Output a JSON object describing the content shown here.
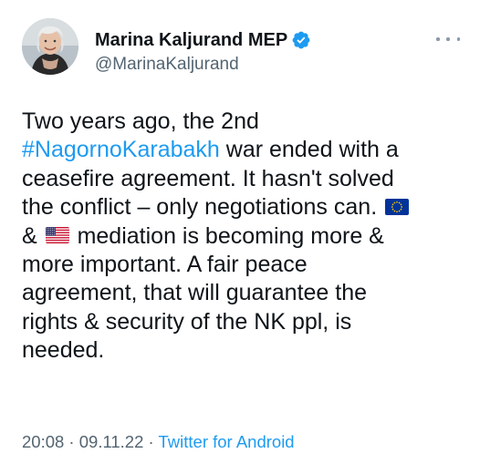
{
  "author": {
    "display_name": "Marina Kaljurand MEP",
    "handle": "@MarinaKaljurand",
    "verified": true,
    "avatar_icon": "profile-photo-avatar"
  },
  "more_icon": "more-dots-icon",
  "tweet": {
    "lines": [
      {
        "parts": [
          {
            "type": "text",
            "value": "Two years ago, the 2nd"
          }
        ]
      },
      {
        "parts": [
          {
            "type": "hashtag",
            "value": "#NagornoKarabakh"
          },
          {
            "type": "text",
            "value": " war ended with a"
          }
        ]
      },
      {
        "parts": [
          {
            "type": "text",
            "value": "ceasefire agreement. It hasn't solved"
          }
        ]
      },
      {
        "parts": [
          {
            "type": "text",
            "value": "the conflict – only negotiations can. "
          },
          {
            "type": "flag",
            "value": "eu-flag"
          }
        ]
      },
      {
        "parts": [
          {
            "type": "text",
            "value": "& "
          },
          {
            "type": "flag",
            "value": "us-flag"
          },
          {
            "type": "text",
            "value": " mediation is becoming more &"
          }
        ]
      },
      {
        "parts": [
          {
            "type": "text",
            "value": "more important. A fair peace"
          }
        ]
      },
      {
        "parts": [
          {
            "type": "text",
            "value": "agreement, that will guarantee the"
          }
        ]
      },
      {
        "parts": [
          {
            "type": "text",
            "value": "rights & security of the NK ppl, is"
          }
        ]
      },
      {
        "parts": [
          {
            "type": "text",
            "value": "needed."
          }
        ]
      }
    ]
  },
  "meta": {
    "time": "20:08",
    "sep1": " · ",
    "date": "09.11.22",
    "sep2": " · ",
    "source": "Twitter for Android"
  },
  "colors": {
    "link": "#1d9bf0",
    "secondary_text": "#536471",
    "primary_text": "#0f1419",
    "verified_badge": "#1d9bf0",
    "eu_blue": "#003399",
    "eu_gold": "#ffcc00"
  }
}
